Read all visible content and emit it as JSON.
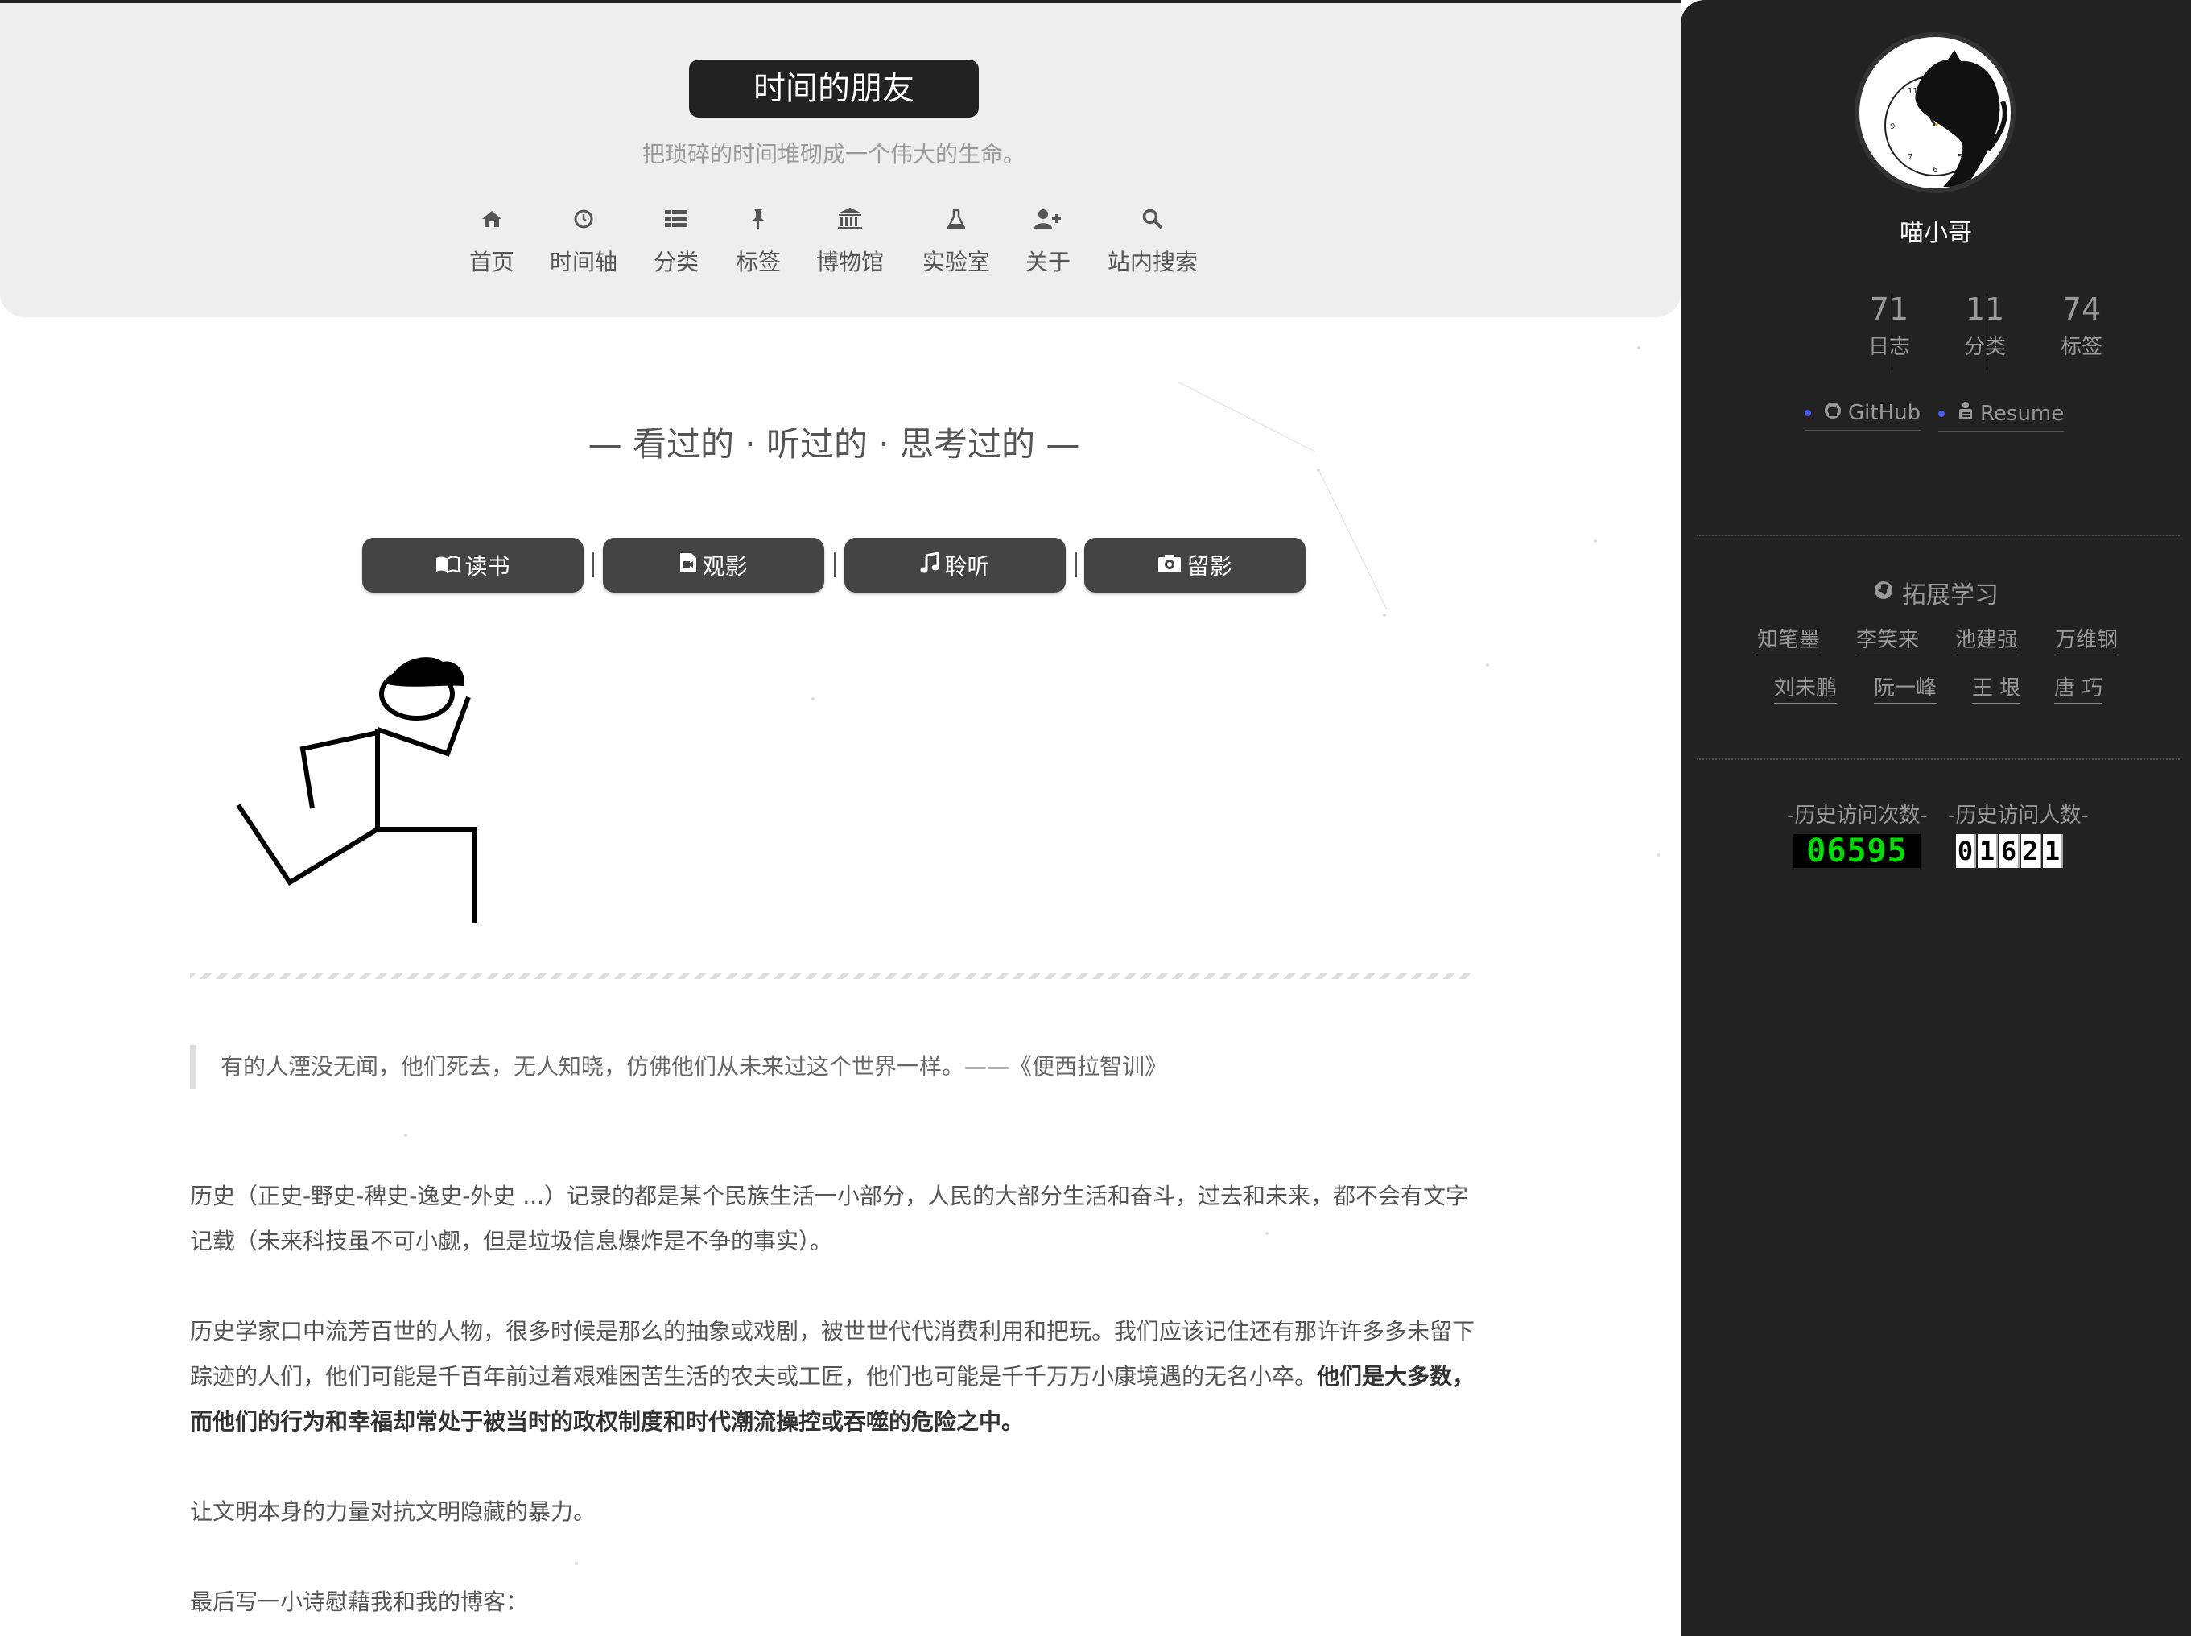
{
  "site": {
    "title": "时间的朋友",
    "subtitle": "把琐碎的时间堆砌成一个伟大的生命。"
  },
  "nav": [
    {
      "icon": "home-icon",
      "label": "首页"
    },
    {
      "icon": "clock-icon",
      "label": "时间轴"
    },
    {
      "icon": "list-icon",
      "label": "分类"
    },
    {
      "icon": "pin-icon",
      "label": "标签"
    },
    {
      "icon": "museum-icon",
      "label": "博物馆"
    },
    {
      "icon": "flask-icon",
      "label": "实验室"
    },
    {
      "icon": "user-plus-icon",
      "label": "关于"
    },
    {
      "icon": "search-icon",
      "label": "站内搜索"
    }
  ],
  "main": {
    "heading": "— 看过的 · 听过的 · 思考过的 —",
    "categories": [
      {
        "icon": "book-icon",
        "label": "读书"
      },
      {
        "icon": "video-file-icon",
        "label": "观影"
      },
      {
        "icon": "music-icon",
        "label": "聆听"
      },
      {
        "icon": "camera-icon",
        "label": "留影"
      }
    ],
    "quote": "有的人湮没无闻，他们死去，无人知晓，仿佛他们从未来过这个世界一样。——《便西拉智训》",
    "p1": "历史（正史-野史-稗史-逸史-外史 ...）记录的都是某个民族生活一小部分，人民的大部分生活和奋斗，过去和未来，都不会有文字记载（未来科技虽不可小觑，但是垃圾信息爆炸是不争的事实）。",
    "p2_a": "历史学家口中流芳百世的人物，很多时候是那么的抽象或戏剧，被世世代代消费利用和把玩。我们应该记住还有那许许多多未留下踪迹的人们，他们可能是千百年前过着艰难困苦生活的农夫或工匠，他们也可能是千千万万小康境遇的无名小卒。",
    "p2_b": "他们是大多数，而他们的行为和幸福却常处于被当时的政权制度和时代潮流操控或吞噬的危险之中。",
    "p3": "让文明本身的力量对抗文明隐藏的暴力。",
    "p4": "最后写一小诗慰藉我和我的博客："
  },
  "sidebar": {
    "author": "喵小哥",
    "stats": [
      {
        "num": "71",
        "label": "日志"
      },
      {
        "num": "11",
        "label": "分类"
      },
      {
        "num": "74",
        "label": "标签"
      }
    ],
    "social": [
      {
        "icon": "github-icon",
        "label": "GitHub"
      },
      {
        "icon": "resume-icon",
        "label": "Resume"
      }
    ],
    "links_title": "拓展学习",
    "links": [
      "知笔墨",
      "李笑来",
      "池建强",
      "万维钢",
      "刘未鹏",
      "阮一峰",
      "王 垠",
      "唐 巧"
    ],
    "counters": {
      "visits_label": "-历史访问次数-",
      "visits": "06595",
      "visitors_label": "-历史访问人数-",
      "visitors": [
        "0",
        "1",
        "6",
        "2",
        "1"
      ]
    },
    "colors": {
      "bullet": "#4b5cf0",
      "counter_green": "#00dd00"
    }
  }
}
